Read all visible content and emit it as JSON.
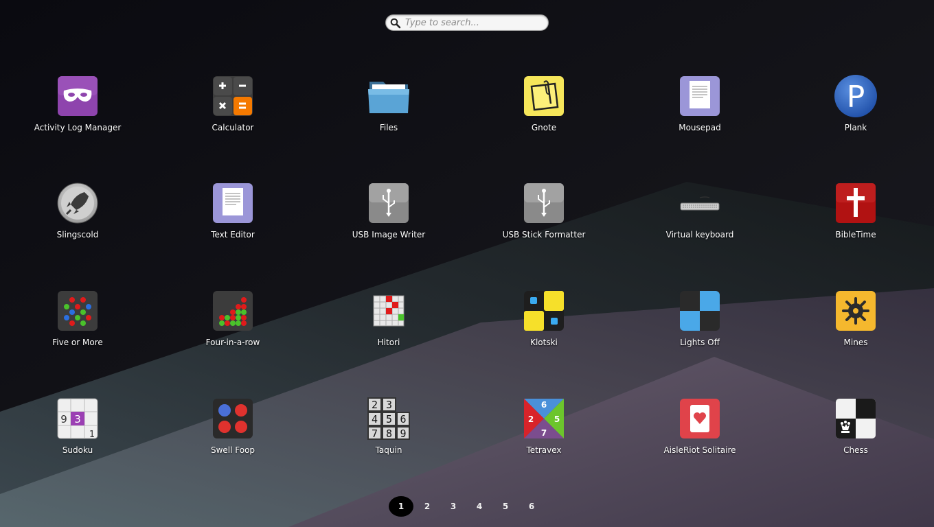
{
  "search": {
    "placeholder": "Type to search..."
  },
  "apps": [
    {
      "label": "Activity Log Manager",
      "icon": "activity-log-manager-icon"
    },
    {
      "label": "Calculator",
      "icon": "calculator-icon"
    },
    {
      "label": "Files",
      "icon": "folder-icon"
    },
    {
      "label": "Gnote",
      "icon": "gnote-icon"
    },
    {
      "label": "Mousepad",
      "icon": "mousepad-icon"
    },
    {
      "label": "Plank",
      "icon": "plank-icon"
    },
    {
      "label": "Slingscold",
      "icon": "rocket-icon"
    },
    {
      "label": "Text Editor",
      "icon": "text-editor-icon"
    },
    {
      "label": "USB Image Writer",
      "icon": "usb-icon"
    },
    {
      "label": "USB Stick Formatter",
      "icon": "usb-icon"
    },
    {
      "label": "Virtual keyboard",
      "icon": "keyboard-icon"
    },
    {
      "label": "BibleTime",
      "icon": "cross-icon"
    },
    {
      "label": "Five or More",
      "icon": "five-or-more-icon"
    },
    {
      "label": "Four-in-a-row",
      "icon": "four-in-a-row-icon"
    },
    {
      "label": "Hitori",
      "icon": "hitori-icon"
    },
    {
      "label": "Klotski",
      "icon": "klotski-icon"
    },
    {
      "label": "Lights Off",
      "icon": "lights-off-icon"
    },
    {
      "label": "Mines",
      "icon": "mines-icon"
    },
    {
      "label": "Sudoku",
      "icon": "sudoku-icon"
    },
    {
      "label": "Swell Foop",
      "icon": "swell-foop-icon"
    },
    {
      "label": "Taquin",
      "icon": "taquin-icon"
    },
    {
      "label": "Tetravex",
      "icon": "tetravex-icon"
    },
    {
      "label": "AisleRiot Solitaire",
      "icon": "card-heart-icon"
    },
    {
      "label": "Chess",
      "icon": "chess-icon"
    }
  ],
  "icon_text": {
    "plank": "P",
    "sudoku": [
      "9",
      "3",
      "1"
    ],
    "taquin": [
      "2",
      "3",
      "4",
      "5",
      "6",
      "7",
      "8",
      "9"
    ],
    "tetravex": [
      "6",
      "2",
      "5",
      "7"
    ]
  },
  "pager": {
    "pages": [
      "1",
      "2",
      "3",
      "4",
      "5",
      "6"
    ],
    "active": "1"
  },
  "colors": {
    "background": "#0b0b12",
    "accent_purple": "#8e44ad",
    "calculator_orange": "#f57900",
    "bibletime_red": "#b11212",
    "mines_yellow": "#f5b82e"
  }
}
